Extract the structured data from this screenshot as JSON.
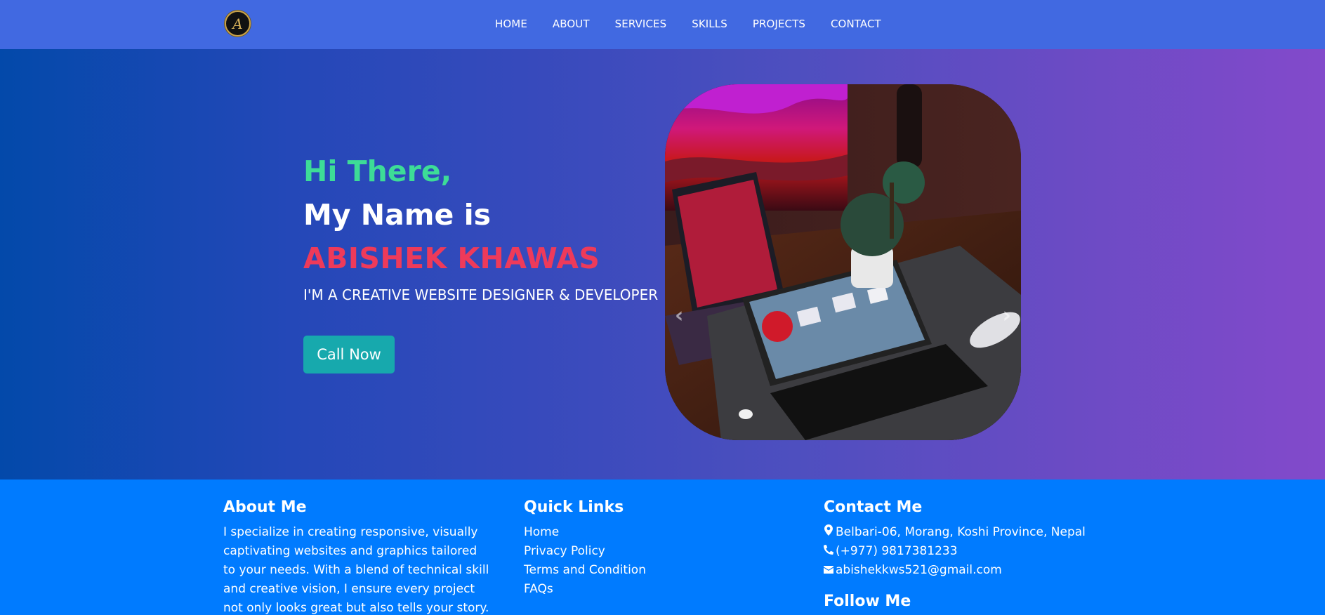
{
  "nav": {
    "logo_letter": "A",
    "links": [
      "HOME",
      "ABOUT",
      "SERVICES",
      "SKILLS",
      "PROJECTS",
      "CONTACT"
    ]
  },
  "hero": {
    "greeting": "Hi There,",
    "intro": "My Name is",
    "name": "ABISHEK KHAWAS",
    "tagline": "I'M A CREATIVE WEBSITE DESIGNER & DEVELOPER",
    "cta_label": "Call Now",
    "carousel_prev": "‹",
    "carousel_next": "›"
  },
  "footer": {
    "about": {
      "heading": "About Me",
      "text": "I specialize in creating responsive, visually captivating websites and graphics tailored to your needs. With a blend of technical skill and creative vision, I ensure every project not only looks great but also tells your story."
    },
    "quick_links": {
      "heading": "Quick Links",
      "items": [
        "Home",
        "Privacy Policy",
        "Terms and Condition",
        "FAQs"
      ]
    },
    "contact": {
      "heading": "Contact Me",
      "address": "Belbari-06, Morang, Koshi Province, Nepal",
      "phone": "(+977) 9817381233",
      "email": "abishekkws521@gmail.com",
      "follow_heading": "Follow Me"
    }
  },
  "colors": {
    "nav_bg": "#4169e1",
    "greeting": "#3ddc97",
    "name": "#ee3a5a",
    "cta_bg": "#17a9ad",
    "footer_bg": "#007bff"
  }
}
